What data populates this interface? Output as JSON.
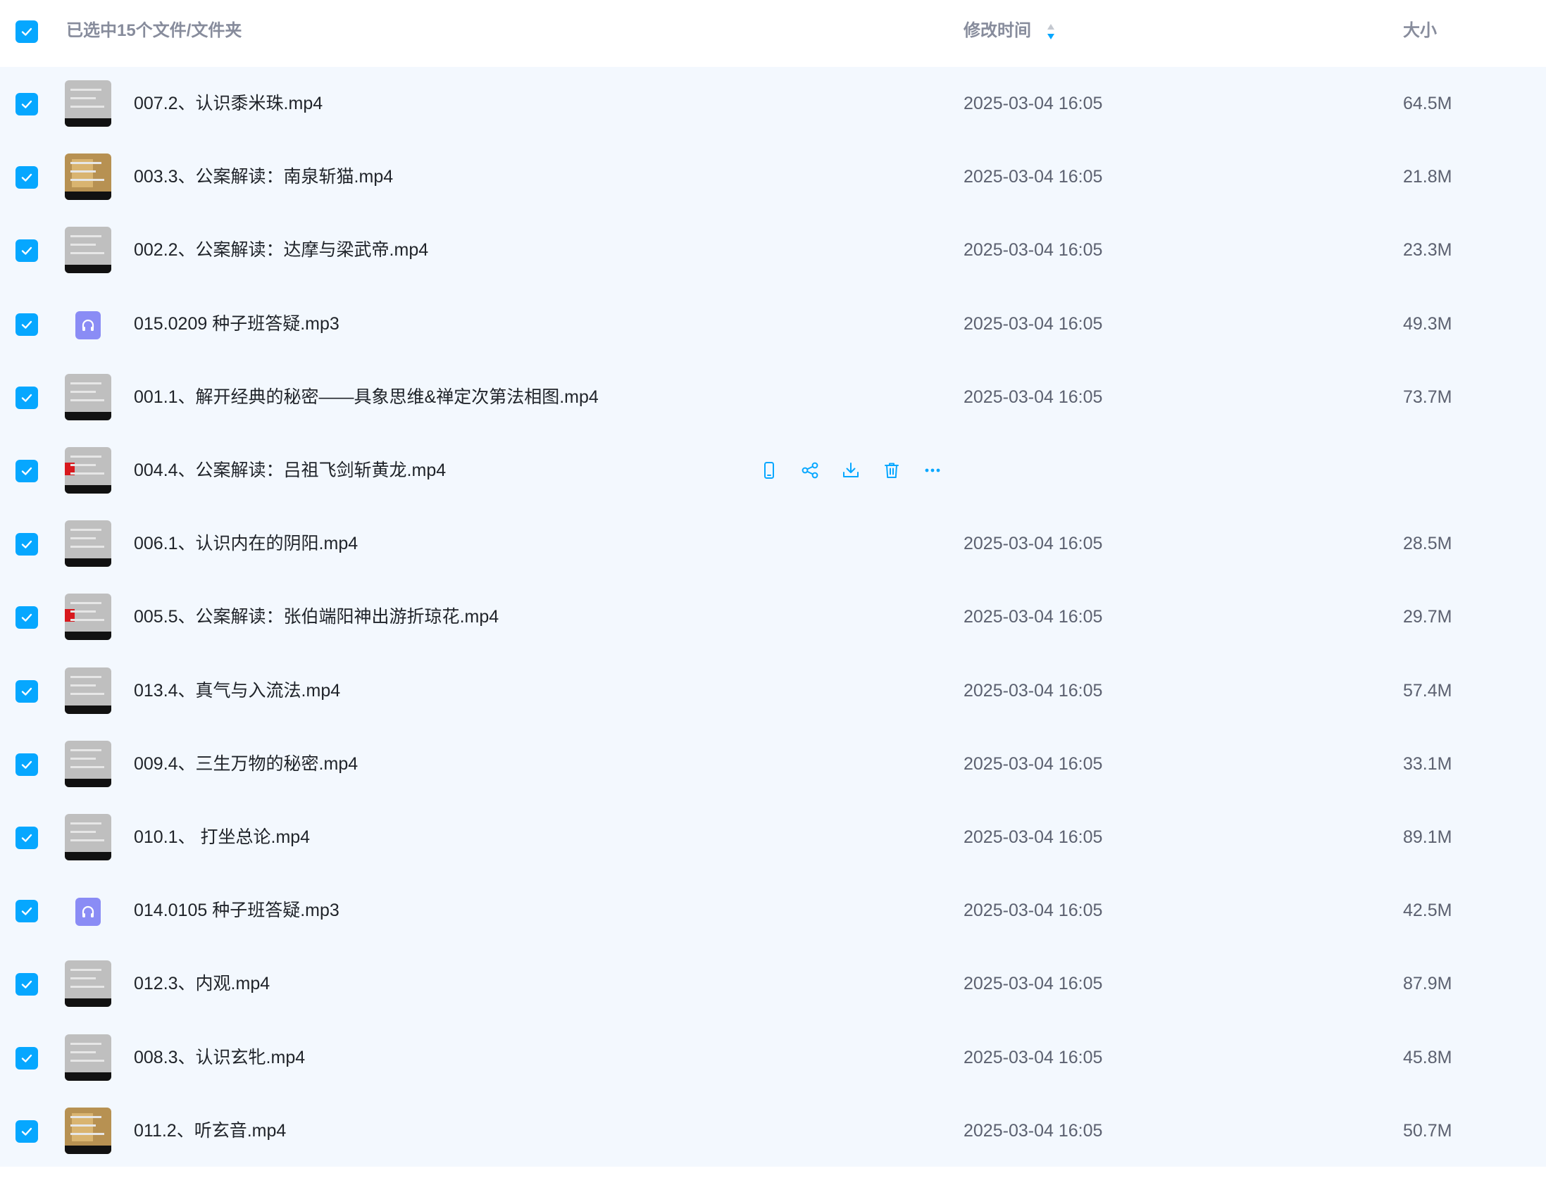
{
  "header": {
    "selected_label": "已选中15个文件/文件夹",
    "modified_col": "修改时间",
    "size_col": "大小"
  },
  "colors": {
    "accent": "#06a7ff",
    "audio_icon": "#8a8cf5",
    "list_bg": "#f3f8fe"
  },
  "rows": [
    {
      "name": "007.2、认识黍米珠.mp4",
      "time": "2025-03-04 16:05",
      "size": "64.5M",
      "kind": "video"
    },
    {
      "name": "003.3、公案解读：南泉斩猫.mp4",
      "time": "2025-03-04 16:05",
      "size": "21.8M",
      "kind": "video-gold"
    },
    {
      "name": "002.2、公案解读：达摩与梁武帝.mp4",
      "time": "2025-03-04 16:05",
      "size": "23.3M",
      "kind": "video"
    },
    {
      "name": "015.0209 种子班答疑.mp3",
      "time": "2025-03-04 16:05",
      "size": "49.3M",
      "kind": "audio"
    },
    {
      "name": "001.1、解开经典的秘密——具象思维&禅定次第法相图.mp4",
      "time": "2025-03-04 16:05",
      "size": "73.7M",
      "kind": "video"
    },
    {
      "name": "004.4、公案解读：吕祖飞剑斩黄龙.mp4",
      "time": "",
      "size": "",
      "kind": "video-red"
    },
    {
      "name": "006.1、认识内在的阴阳.mp4",
      "time": "2025-03-04 16:05",
      "size": "28.5M",
      "kind": "video"
    },
    {
      "name": "005.5、公案解读：张伯端阳神出游折琼花.mp4",
      "time": "2025-03-04 16:05",
      "size": "29.7M",
      "kind": "video-red"
    },
    {
      "name": "013.4、真气与入流法.mp4",
      "time": "2025-03-04 16:05",
      "size": "57.4M",
      "kind": "video"
    },
    {
      "name": "009.4、三生万物的秘密.mp4",
      "time": "2025-03-04 16:05",
      "size": "33.1M",
      "kind": "video"
    },
    {
      "name": "010.1、 打坐总论.mp4",
      "time": "2025-03-04 16:05",
      "size": "89.1M",
      "kind": "video"
    },
    {
      "name": "014.0105 种子班答疑.mp3",
      "time": "2025-03-04 16:05",
      "size": "42.5M",
      "kind": "audio"
    },
    {
      "name": "012.3、内观.mp4",
      "time": "2025-03-04 16:05",
      "size": "87.9M",
      "kind": "video"
    },
    {
      "name": "008.3、认识玄牝.mp4",
      "time": "2025-03-04 16:05",
      "size": "45.8M",
      "kind": "video"
    },
    {
      "name": "011.2、听玄音.mp4",
      "time": "2025-03-04 16:05",
      "size": "50.7M",
      "kind": "video-gold"
    }
  ],
  "hovered_row_actions": [
    "phone-icon",
    "share-icon",
    "download-icon",
    "delete-icon",
    "more-icon"
  ]
}
